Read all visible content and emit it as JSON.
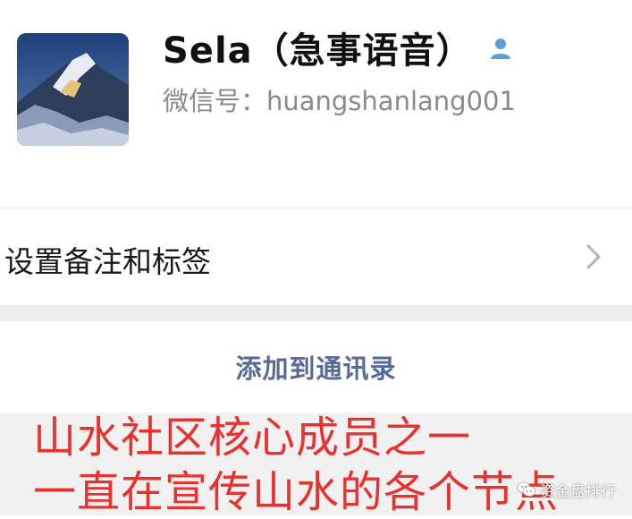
{
  "profile": {
    "name": "Sela（急事语音）",
    "wechat_id": "微信号：huangshanlang001",
    "avatar_icon": "mountain-avatar",
    "gender_icon": "person-icon",
    "gender_color": "#5a9fd6"
  },
  "remark_row": {
    "label": "设置备注和标签",
    "chevron_icon": "chevron-right-icon"
  },
  "actions": {
    "add_contact": "添加到通讯录",
    "link_color": "#576b95"
  },
  "caption": {
    "line1": "山水社区核心成员之一",
    "line2": "一直在宣传山水的各个节点",
    "color": "#e8322f"
  },
  "watermark": {
    "text": "资金盘排行",
    "icon": "wechat-icon"
  }
}
